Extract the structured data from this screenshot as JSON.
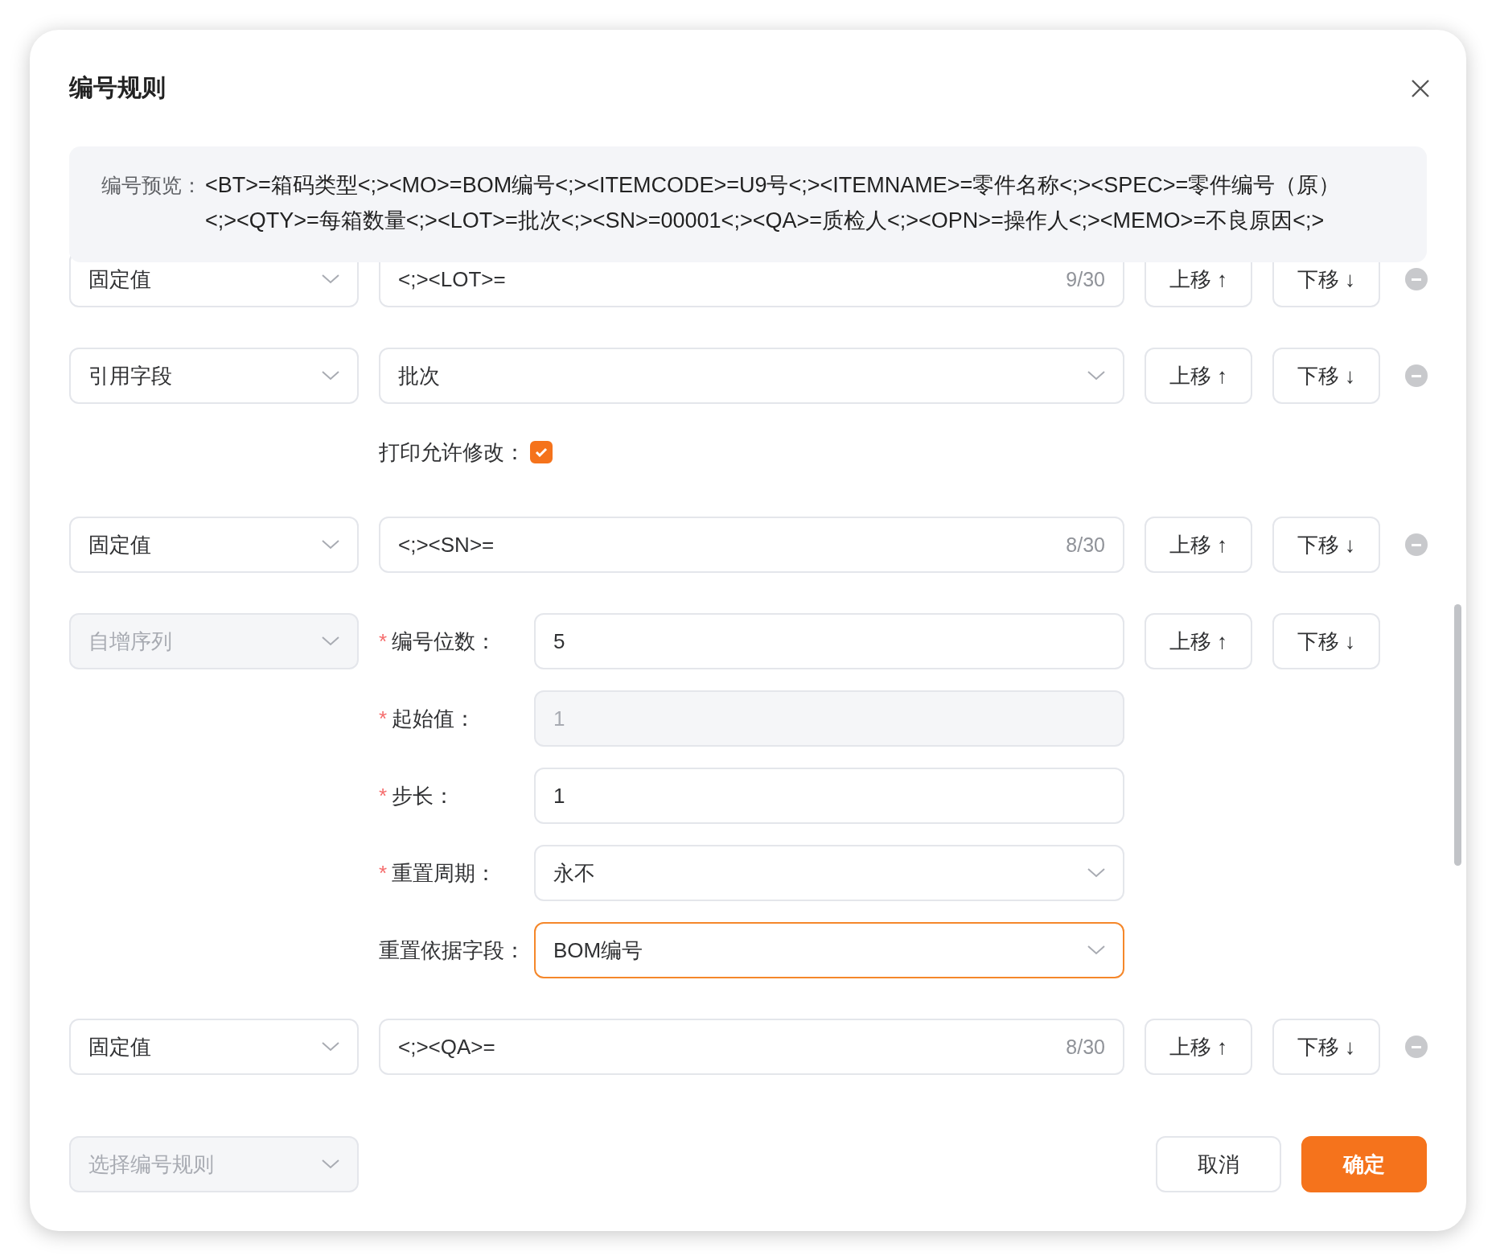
{
  "dialog": {
    "title": "编号规则"
  },
  "preview": {
    "label": "编号预览：",
    "lines": [
      "<BT>=箱码类型<;><MO>=BOM编号<;><ITEMCODE>=U9号<;><ITEMNAME>=零件名称<;><SPEC>=零件编号（原）",
      "<;><QTY>=每箱数量<;><LOT>=批次<;><SN>=00001<;><QA>=质检人<;><OPN>=操作人<;><MEMO>=不良原因<;>"
    ]
  },
  "rows": [
    {
      "kind": "fixed",
      "type": "固定值",
      "disabled": false,
      "value": "<;><LOT>=",
      "counter": "9/30",
      "up": "上移 ↑",
      "down": "下移 ↓",
      "removable": true
    },
    {
      "kind": "field",
      "type": "引用字段",
      "disabled": false,
      "value": "批次",
      "option": {
        "label": "打印允许修改：",
        "checked": true
      },
      "up": "上移 ↑",
      "down": "下移 ↓",
      "removable": true
    },
    {
      "kind": "fixed",
      "type": "固定值",
      "disabled": false,
      "value": "<;><SN>=",
      "counter": "8/30",
      "up": "上移 ↑",
      "down": "下移 ↓",
      "removable": true
    },
    {
      "kind": "sequence",
      "type": "自增序列",
      "disabled": true,
      "fields": [
        {
          "kind": "input",
          "required_mark": "*",
          "label": "编号位数：",
          "value": "5",
          "disabled": false,
          "focused": false
        },
        {
          "kind": "input",
          "required_mark": "*",
          "label": "起始值：",
          "value": "1",
          "disabled": true,
          "focused": false
        },
        {
          "kind": "input",
          "required_mark": "*",
          "label": "步长：",
          "value": "1",
          "disabled": false,
          "focused": false
        },
        {
          "kind": "select",
          "required_mark": "*",
          "label": "重置周期：",
          "value": "永不",
          "disabled": false,
          "focused": false
        },
        {
          "kind": "select",
          "label": "重置依据字段：",
          "value": "BOM编号",
          "disabled": false,
          "focused": true
        }
      ],
      "up": "上移 ↑",
      "down": "下移 ↓",
      "removable": false
    },
    {
      "kind": "fixed",
      "type": "固定值",
      "disabled": false,
      "value": "<;><QA>=",
      "counter": "8/30",
      "up": "上移 ↑",
      "down": "下移 ↓",
      "removable": true
    }
  ],
  "footer": {
    "rule_select": {
      "placeholder": "选择编号规则"
    },
    "buttons": [
      {
        "kind": "secondary",
        "label": "取消"
      },
      {
        "kind": "primary",
        "label": "确定"
      }
    ]
  }
}
